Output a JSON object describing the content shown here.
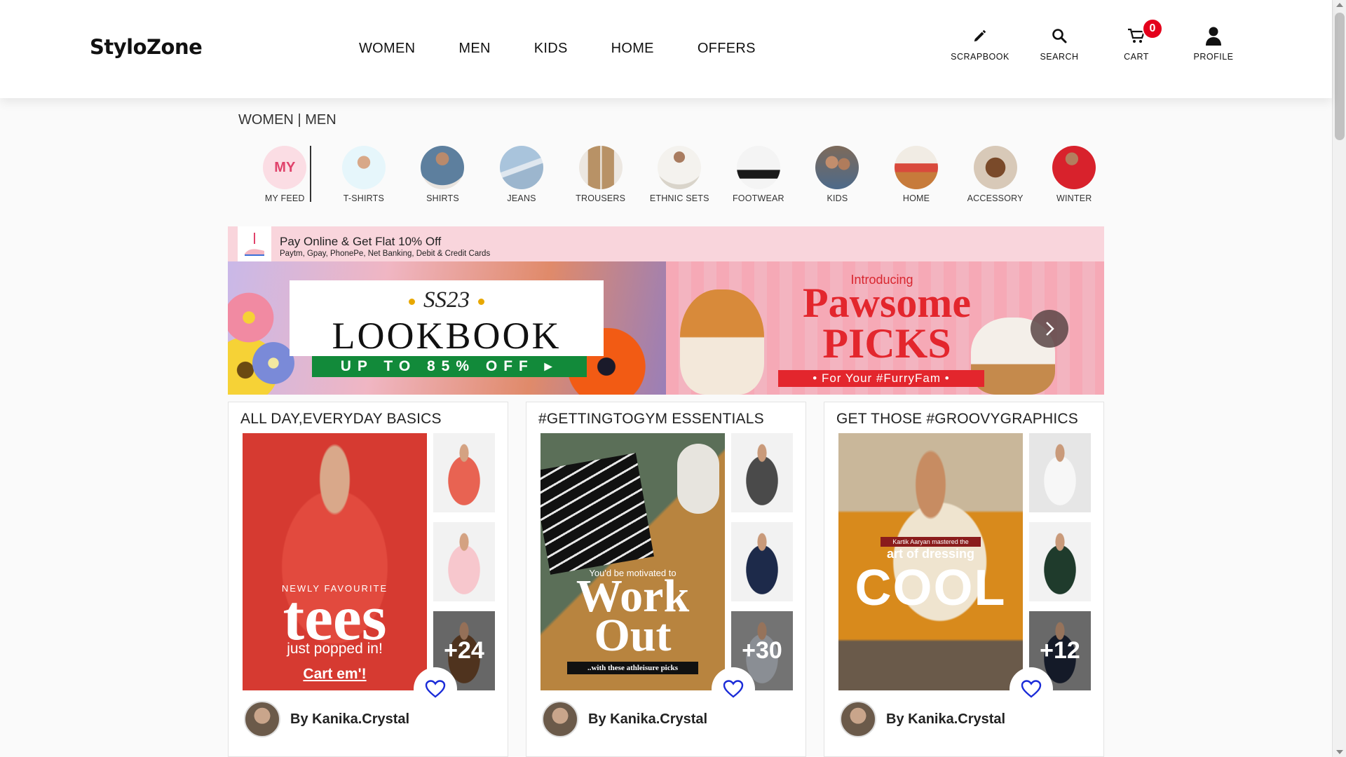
{
  "brand": {
    "logo": "StyloZone"
  },
  "nav": {
    "items": [
      "WOMEN",
      "MEN",
      "KIDS",
      "HOME",
      "OFFERS"
    ]
  },
  "actions": {
    "scrapbook": {
      "label": "SCRAPBOOK",
      "icon": "pencil-icon"
    },
    "search": {
      "label": "SEARCH",
      "icon": "search-icon"
    },
    "cart": {
      "label": "CART",
      "icon": "cart-icon",
      "count": "0"
    },
    "profile": {
      "label": "PROFILE",
      "icon": "user-icon"
    }
  },
  "gender_switch": {
    "women": "WOMEN",
    "separator": "|",
    "men": "MEN"
  },
  "categories": [
    {
      "label": "MY FEED",
      "badge": "MY"
    },
    {
      "label": "T-SHIRTS"
    },
    {
      "label": "SHIRTS"
    },
    {
      "label": "JEANS"
    },
    {
      "label": "TROUSERS"
    },
    {
      "label": "ETHNIC SETS"
    },
    {
      "label": "FOOTWEAR"
    },
    {
      "label": "KIDS"
    },
    {
      "label": "HOME"
    },
    {
      "label": "ACCESSORY"
    },
    {
      "label": "WINTER"
    }
  ],
  "offer": {
    "title": "Pay Online & Get Flat 10% Off",
    "subtitle": "Paytm, Gpay, PhonePe, Net Banking, Debit & Credit Cards"
  },
  "banners": {
    "lookbook": {
      "season": "SS23",
      "title": "LOOKBOOK",
      "cta": "UP TO 85% OFF ▸"
    },
    "pawsome": {
      "intro": "Introducing",
      "title_line1": "Pawsome",
      "title_line2": "PICKS",
      "tagline": "• For Your #FurryFam •"
    }
  },
  "cards": [
    {
      "title": "ALL DAY,EVERYDAY BASICS",
      "more": "+24",
      "author": "By Kanika.Crystal",
      "overlay": {
        "line1": "NEWLY FAVOURITE",
        "line2": "tees",
        "line3": "just popped in!",
        "line4": "Cart em'!"
      }
    },
    {
      "title": "#GETTINGTOGYM ESSENTIALS",
      "more": "+30",
      "author": "By Kanika.Crystal",
      "overlay": {
        "line1": "You'd be motivated to",
        "line2": "Work Out",
        "line3": "..with these athleisure picks"
      }
    },
    {
      "title": "GET THOSE #GROOVYGRAPHICS",
      "more": "+12",
      "author": "By Kanika.Crystal",
      "overlay": {
        "line1": "Kartik Aaryan mastered the",
        "line2": "art of dressing",
        "line3": "COOL"
      }
    }
  ],
  "colors": {
    "cart_badge": "#e4001b",
    "offer_bg": "#f9d5dc",
    "heart": "#1a2bd8",
    "myfeed": "#e0426b"
  }
}
